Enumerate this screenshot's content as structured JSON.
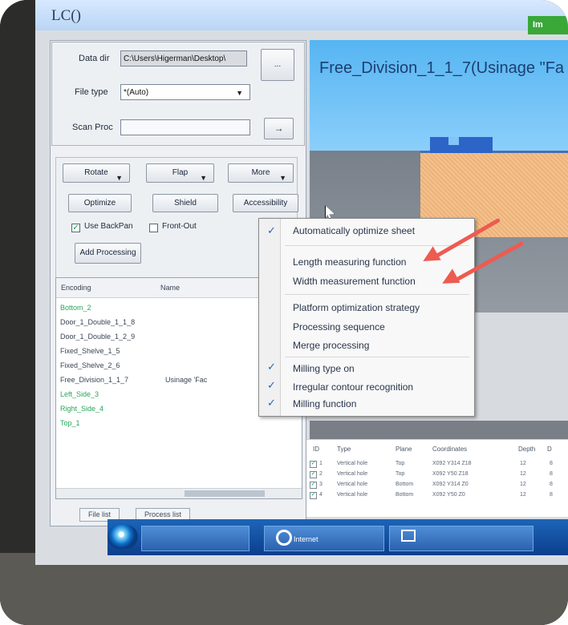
{
  "window": {
    "title": "LC()",
    "title_badge": "Im"
  },
  "left_panel": {
    "data_dir_label": "Data dir",
    "data_dir_value": "C:\\Users\\Higerman\\Desktop\\",
    "browse_label": "...",
    "file_type_label": "File type",
    "file_type_value": "*(Auto)",
    "scan_proc_label": "Scan Proc",
    "scan_proc_button": "→",
    "buttons": {
      "rotate": "Rotate",
      "flap": "Flap",
      "more": "More",
      "optimize": "Optimize",
      "shield": "Shield",
      "accessibility": "Accessibility",
      "add_processing": "Add Processing"
    },
    "checkboxes": {
      "use_backpan": "Use BackPan",
      "front_out": "Front-Out"
    }
  },
  "parts_list": {
    "headers": [
      "Encoding",
      "Name"
    ],
    "rows": [
      {
        "encoding": "Bottom_2",
        "name": ""
      },
      {
        "encoding": "Door_1_Double_1_1_8",
        "name": ""
      },
      {
        "encoding": "Door_1_Double_1_2_9",
        "name": ""
      },
      {
        "encoding": "Fixed_Shelve_1_5",
        "name": ""
      },
      {
        "encoding": "Fixed_Shelve_2_6",
        "name": ""
      },
      {
        "encoding": "Free_Division_1_1_7",
        "name": "Usinage 'Fac"
      },
      {
        "encoding": "Left_Side_3",
        "name": ""
      },
      {
        "encoding": "Right_Side_4",
        "name": ""
      },
      {
        "encoding": "Top_1",
        "name": ""
      }
    ],
    "tabs": [
      "File list",
      "Process list"
    ]
  },
  "viewer": {
    "title": "Free_Division_1_1_7(Usinage \"Fa"
  },
  "menu": {
    "items": [
      {
        "label": "Automatically optimize sheet",
        "checked": true
      },
      {
        "label": "Length measuring function",
        "checked": false
      },
      {
        "label": "Width measurement function",
        "checked": false
      },
      {
        "label": "Platform optimization strategy",
        "checked": false
      },
      {
        "label": "Processing sequence",
        "checked": false
      },
      {
        "label": "Merge processing",
        "checked": false
      },
      {
        "label": "Milling type on",
        "checked": true
      },
      {
        "label": "Irregular contour recognition",
        "checked": true
      },
      {
        "label": "Milling function",
        "checked": true
      }
    ]
  },
  "operations_table": {
    "headers": [
      "ID",
      "Type",
      "Plane",
      "Coordinates",
      "Depth",
      "D"
    ],
    "rows": [
      {
        "id": "1",
        "type": "Vertical hole",
        "plane": "Top",
        "coordinates": "X092 Y314 Z18",
        "depth": "12",
        "d": "8"
      },
      {
        "id": "2",
        "type": "Vertical hole",
        "plane": "Top",
        "coordinates": "X092 Y50 Z18",
        "depth": "12",
        "d": "8"
      },
      {
        "id": "3",
        "type": "Vertical hole",
        "plane": "Bottom",
        "coordinates": "X092 Y314 Z0",
        "depth": "12",
        "d": "8"
      },
      {
        "id": "4",
        "type": "Vertical hole",
        "plane": "Bottom",
        "coordinates": "X092 Y50 Z0",
        "depth": "12",
        "d": "8"
      }
    ]
  },
  "taskbar": {
    "items": [
      "",
      "Internet",
      ""
    ]
  },
  "colors": {
    "accent": "#2164c6",
    "annotation": "#ed5b51",
    "green_text": "#28a65a"
  }
}
